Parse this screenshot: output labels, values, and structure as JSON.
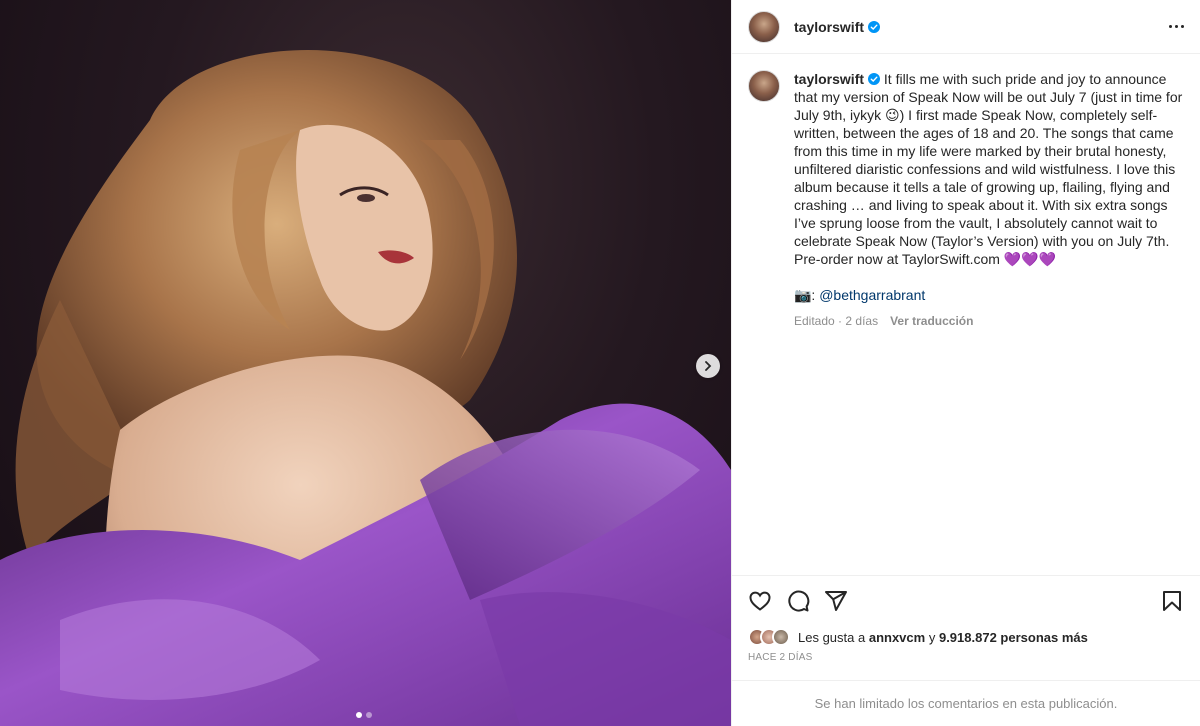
{
  "post": {
    "username": "taylorswift",
    "verified_badge_color": "#0095f6",
    "caption_text": "It fills me with such pride and joy to announce that my version of Speak Now will be out July 7 (just in time for July 9th, iykyk 😉) I first made Speak Now, completely self-written, between the ages of 18 and 20. The songs that came from this time in my life were marked by their brutal honesty, unfiltered diaristic confessions and wild wistfulness. I love this album because it tells a tale of growing up, flailing, flying and crashing … and living to speak about it. With six extra songs I’ve sprung loose from the vault, I absolutely cannot wait to celebrate Speak Now (Taylor’s Version) with you on July 7th. Pre-order now at TaylorSwift.com 💜💜💜",
    "photo_credit_prefix": "📷:",
    "photo_credit_handle": "@bethgarrabrant",
    "edited_label": "Editado",
    "meta_separator": "·",
    "edited_ago": "2 días",
    "translate_label": "Ver traducción",
    "likes_prefix": "Les gusta a",
    "likes_user": "annxvcm",
    "likes_conj": "y",
    "likes_count": "9.918.872 personas más",
    "time_ago": "Hace 2 días",
    "comments_limited": "Se han limitado los comentarios en esta publicación."
  },
  "media": {
    "carousel_total": 2,
    "carousel_index": 1,
    "dress_color": "#8a45b8",
    "background_color": "#1f141b"
  },
  "icons": {
    "like": "heart-icon",
    "comment": "comment-icon",
    "share": "paper-plane-icon",
    "save": "bookmark-icon",
    "more": "more-options-icon",
    "next": "chevron-right-icon"
  }
}
